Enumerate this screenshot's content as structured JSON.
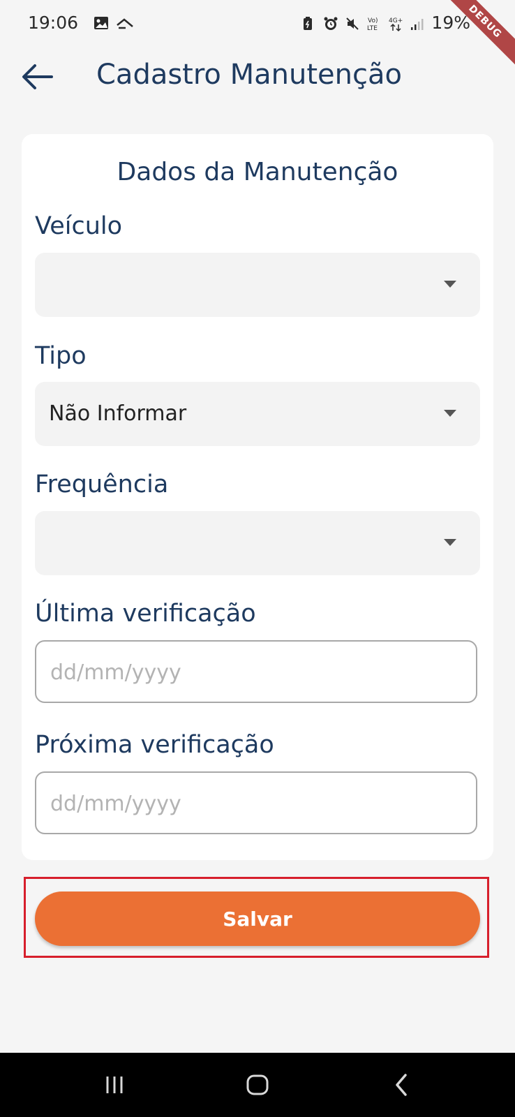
{
  "status_bar": {
    "time": "19:06",
    "battery": "19%",
    "icons": [
      "image-icon",
      "email-icon",
      "battery-saver-icon",
      "alarm-icon",
      "mute-icon",
      "volte-icon",
      "4g-icon",
      "signal-icon"
    ],
    "debug_label": "DEBUG"
  },
  "app_bar": {
    "title": "Cadastro Manutenção",
    "back_icon": "arrow-left-icon"
  },
  "form": {
    "section_title": "Dados da Manutenção",
    "fields": {
      "veiculo": {
        "label": "Veículo",
        "value": ""
      },
      "tipo": {
        "label": "Tipo",
        "value": "Não Informar"
      },
      "frequencia": {
        "label": "Frequência",
        "value": ""
      },
      "ultima_verificacao": {
        "label": "Última verificação",
        "placeholder": "dd/mm/yyyy",
        "value": ""
      },
      "proxima_verificacao": {
        "label": "Próxima verificação",
        "placeholder": "dd/mm/yyyy",
        "value": ""
      }
    },
    "save_label": "Salvar"
  },
  "colors": {
    "primary_text": "#1e3a5f",
    "accent": "#eb7034",
    "highlight": "#d71f2c",
    "background": "#f5f5f5"
  },
  "nav_bar": {
    "icons": [
      "recent-apps-icon",
      "home-icon",
      "back-nav-icon"
    ]
  }
}
